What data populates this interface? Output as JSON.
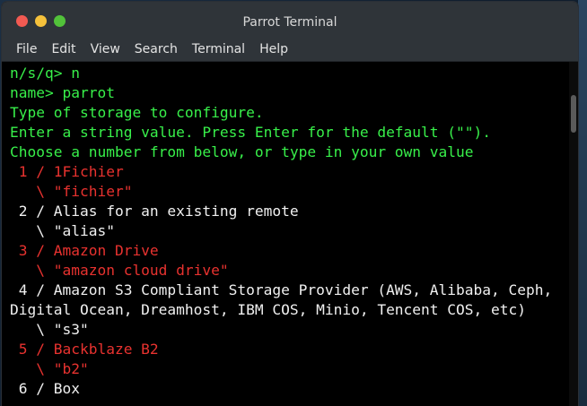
{
  "window": {
    "title": "Parrot Terminal",
    "buttons": [
      {
        "name": "close",
        "color": "#f25a52"
      },
      {
        "name": "minimize",
        "color": "#f5c13b"
      },
      {
        "name": "maximize",
        "color": "#52c23a"
      }
    ]
  },
  "menu": {
    "items": [
      "File",
      "Edit",
      "View",
      "Search",
      "Terminal",
      "Help"
    ]
  },
  "terminal": {
    "lines": [
      {
        "text": "n/s/q> n",
        "color": "green"
      },
      {
        "text": "name> parrot",
        "color": "green"
      },
      {
        "text": "Type of storage to configure.",
        "color": "green"
      },
      {
        "text": "Enter a string value. Press Enter for the default (\"\").",
        "color": "green"
      },
      {
        "text": "Choose a number from below, or type in your own value",
        "color": "green"
      },
      {
        "text": " 1 / 1Fichier",
        "color": "red"
      },
      {
        "text": "   \\ \"fichier\"",
        "color": "red"
      },
      {
        "text": " 2 / Alias for an existing remote",
        "color": "white"
      },
      {
        "text": "   \\ \"alias\"",
        "color": "white"
      },
      {
        "text": " 3 / Amazon Drive",
        "color": "red"
      },
      {
        "text": "   \\ \"amazon cloud drive\"",
        "color": "red"
      },
      {
        "text": " 4 / Amazon S3 Compliant Storage Provider (AWS, Alibaba, Ceph,",
        "color": "white"
      },
      {
        "text": "Digital Ocean, Dreamhost, IBM COS, Minio, Tencent COS, etc)",
        "color": "white"
      },
      {
        "text": "   \\ \"s3\"",
        "color": "white"
      },
      {
        "text": " 5 / Backblaze B2",
        "color": "red"
      },
      {
        "text": "   \\ \"b2\"",
        "color": "red"
      },
      {
        "text": " 6 / Box",
        "color": "white"
      }
    ]
  }
}
